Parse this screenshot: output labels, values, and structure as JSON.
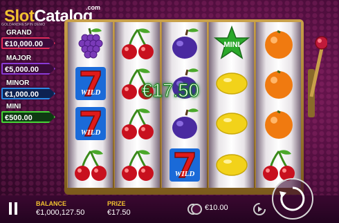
{
  "logo": {
    "slot": "Slot",
    "catalog": "Catalog",
    "com": ".com"
  },
  "demo_label": "GOLDANDRESPIN DEMO",
  "jackpots": [
    {
      "name": "GRAND",
      "value": "€10,000.00",
      "color": "#e02c5a"
    },
    {
      "name": "MAJOR",
      "value": "€5,000.00",
      "color": "#8a3ad6"
    },
    {
      "name": "MINOR",
      "value": "€1,000.00",
      "color": "#2a8ae6"
    },
    {
      "name": "MINI",
      "value": "€500.00",
      "color": "#46d636"
    }
  ],
  "reels": [
    [
      "grapes",
      "seven-wild",
      "seven-wild",
      "cherries"
    ],
    [
      "cherries",
      "cherries",
      "cherries",
      "cherries"
    ],
    [
      "plums",
      "plums",
      "plums",
      "seven-wild"
    ],
    [
      "mini-star",
      "lemon",
      "lemon",
      "lemon"
    ],
    [
      "orange",
      "orange",
      "orange",
      "cherries"
    ]
  ],
  "symbol_texts": {
    "wild": "WILD",
    "mini": "MINI"
  },
  "win_amount": "€17.50",
  "bottom_bar": {
    "balance_label": "BALANCE",
    "balance_value": "€1,000,127.50",
    "prize_label": "PRIZE",
    "prize_value": "€17.50",
    "bet_value": "€10.00"
  },
  "icons": [
    "pause-icon",
    "coins-icon",
    "autoplay-icon",
    "spin-icon",
    "lever-icon"
  ],
  "colors": {
    "accent_gold": "#f2c230",
    "win_green": "#1a8a1a",
    "background": "#4a0c3a"
  }
}
